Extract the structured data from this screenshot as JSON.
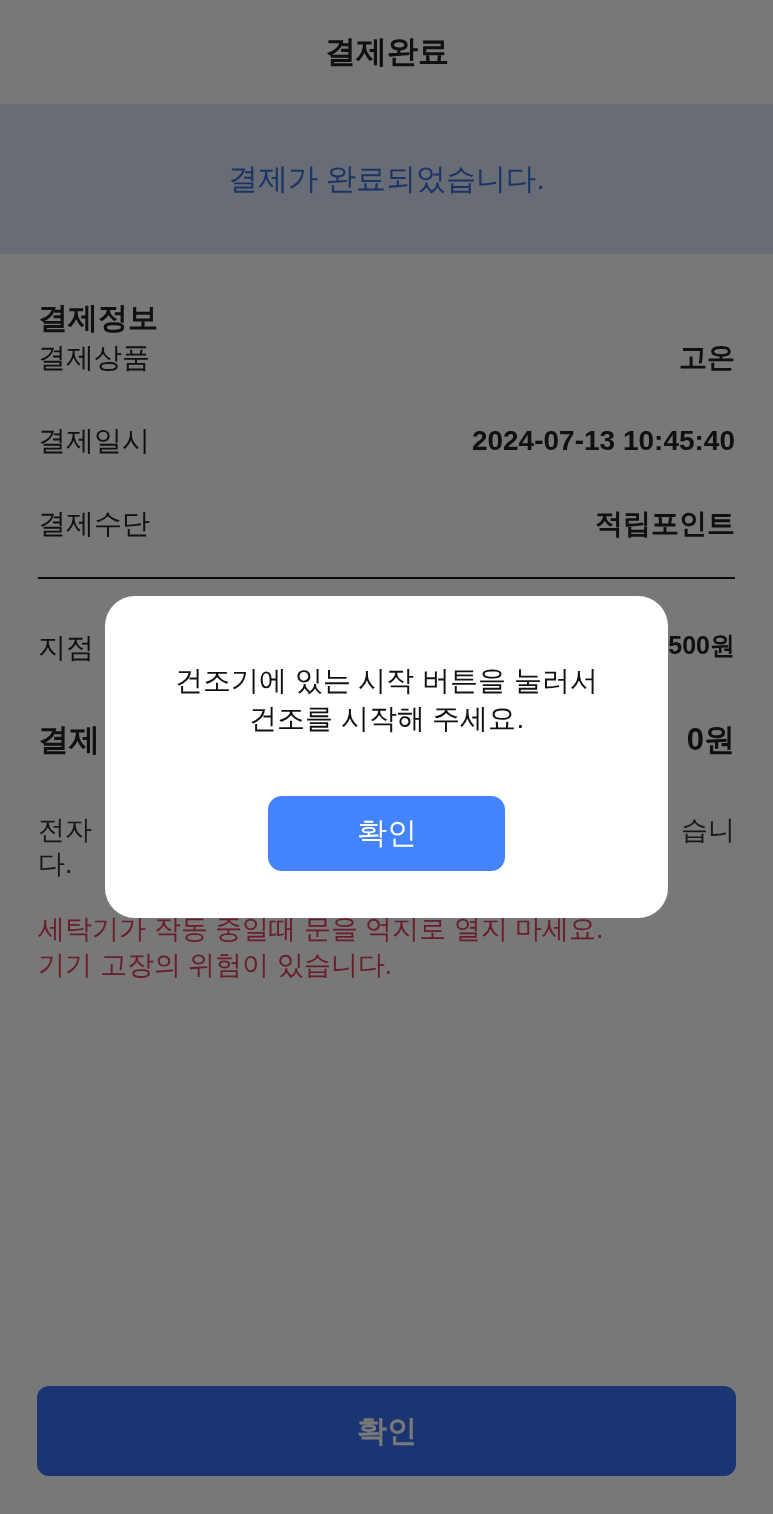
{
  "header": {
    "title": "결제완료"
  },
  "banner": {
    "message": "결제가 완료되었습니다."
  },
  "payment_info": {
    "heading": "결제정보",
    "rows": [
      {
        "label": "결제상품",
        "value": "고온"
      },
      {
        "label": "결제일시",
        "value": "2024-07-13 10:45:40"
      },
      {
        "label": "결제수단",
        "value": "적립포인트"
      }
    ]
  },
  "summary_rows": [
    {
      "kind": "normal",
      "label": "지점",
      "value": "500원"
    },
    {
      "kind": "total",
      "label": "결제",
      "value": "0원"
    }
  ],
  "notice": {
    "start": "전자",
    "end": "습니",
    "wrap": "다."
  },
  "warning": [
    "세탁기가 작동 중일때 문을 억지로 열지 마세요.",
    "기기 고장의 위험이 있습니다."
  ],
  "confirm_button": "확인",
  "dialog": {
    "message_lines": [
      "건조기에 있는 시작 버튼을 눌러서",
      "건조를 시작해 주세요."
    ],
    "button": "확인"
  }
}
